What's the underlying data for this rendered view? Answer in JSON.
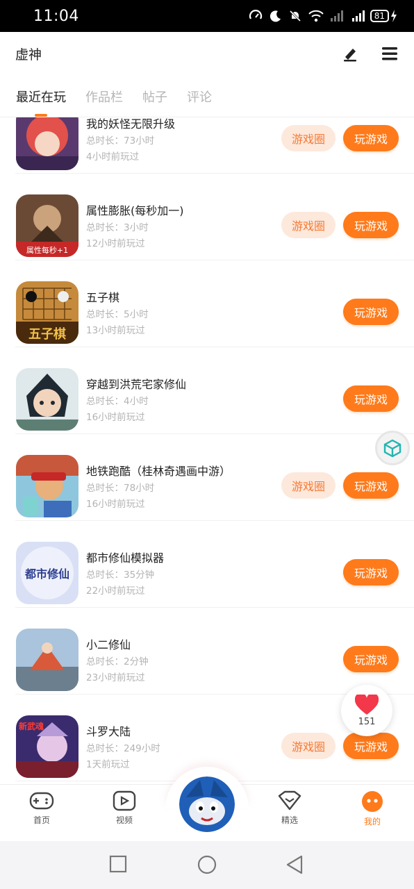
{
  "status_bar": {
    "time": "11:04",
    "battery": "81",
    "network": "4G"
  },
  "header": {
    "title": "虚神",
    "edit_icon": "pen-icon",
    "menu_icon": "menu-icon"
  },
  "tabs": [
    {
      "label": "最近在玩",
      "active": true
    },
    {
      "label": "作品栏",
      "active": false
    },
    {
      "label": "帖子",
      "active": false
    },
    {
      "label": "评论",
      "active": false
    }
  ],
  "buttons": {
    "circle": "游戏圈",
    "play": "玩游戏"
  },
  "games": [
    {
      "name": "我的妖怪无限升级",
      "duration": "总时长：73小时",
      "last_played": "4小时前玩过",
      "has_circle": true
    },
    {
      "name": "属性膨胀(每秒加一)",
      "duration": "总时长：3小时",
      "last_played": "12小时前玩过",
      "has_circle": true,
      "icon_text": "属性每秒+1"
    },
    {
      "name": "五子棋",
      "duration": "总时长：5小时",
      "last_played": "13小时前玩过",
      "has_circle": false,
      "icon_text": "五子棋"
    },
    {
      "name": "穿越到洪荒宅家修仙",
      "duration": "总时长：4小时",
      "last_played": "16小时前玩过",
      "has_circle": false
    },
    {
      "name": "地铁跑酷（桂林奇遇画中游）",
      "duration": "总时长：78小时",
      "last_played": "16小时前玩过",
      "has_circle": true
    },
    {
      "name": "都市修仙模拟器",
      "duration": "总时长：35分钟",
      "last_played": "22小时前玩过",
      "has_circle": false,
      "icon_text": "都市修仙"
    },
    {
      "name": "小二修仙",
      "duration": "总时长：2分钟",
      "last_played": "23小时前玩过",
      "has_circle": false
    },
    {
      "name": "斗罗大陆",
      "duration": "总时长：249小时",
      "last_played": "1天前玩过",
      "has_circle": true,
      "icon_text": "新武魂"
    }
  ],
  "like_bubble": {
    "count": "151",
    "icon": "heart-icon"
  },
  "bottom_nav": [
    {
      "label": "首页",
      "icon": "gamepad-icon",
      "active": false
    },
    {
      "label": "视频",
      "icon": "video-icon",
      "active": false
    },
    {
      "label": "精选",
      "icon": "featured-icon",
      "active": false
    },
    {
      "label": "我的",
      "icon": "profile-icon",
      "active": true
    }
  ],
  "colors": {
    "accent": "#ff7a1a",
    "circle_bg": "#fde8dc",
    "circle_text": "#f57a33"
  }
}
